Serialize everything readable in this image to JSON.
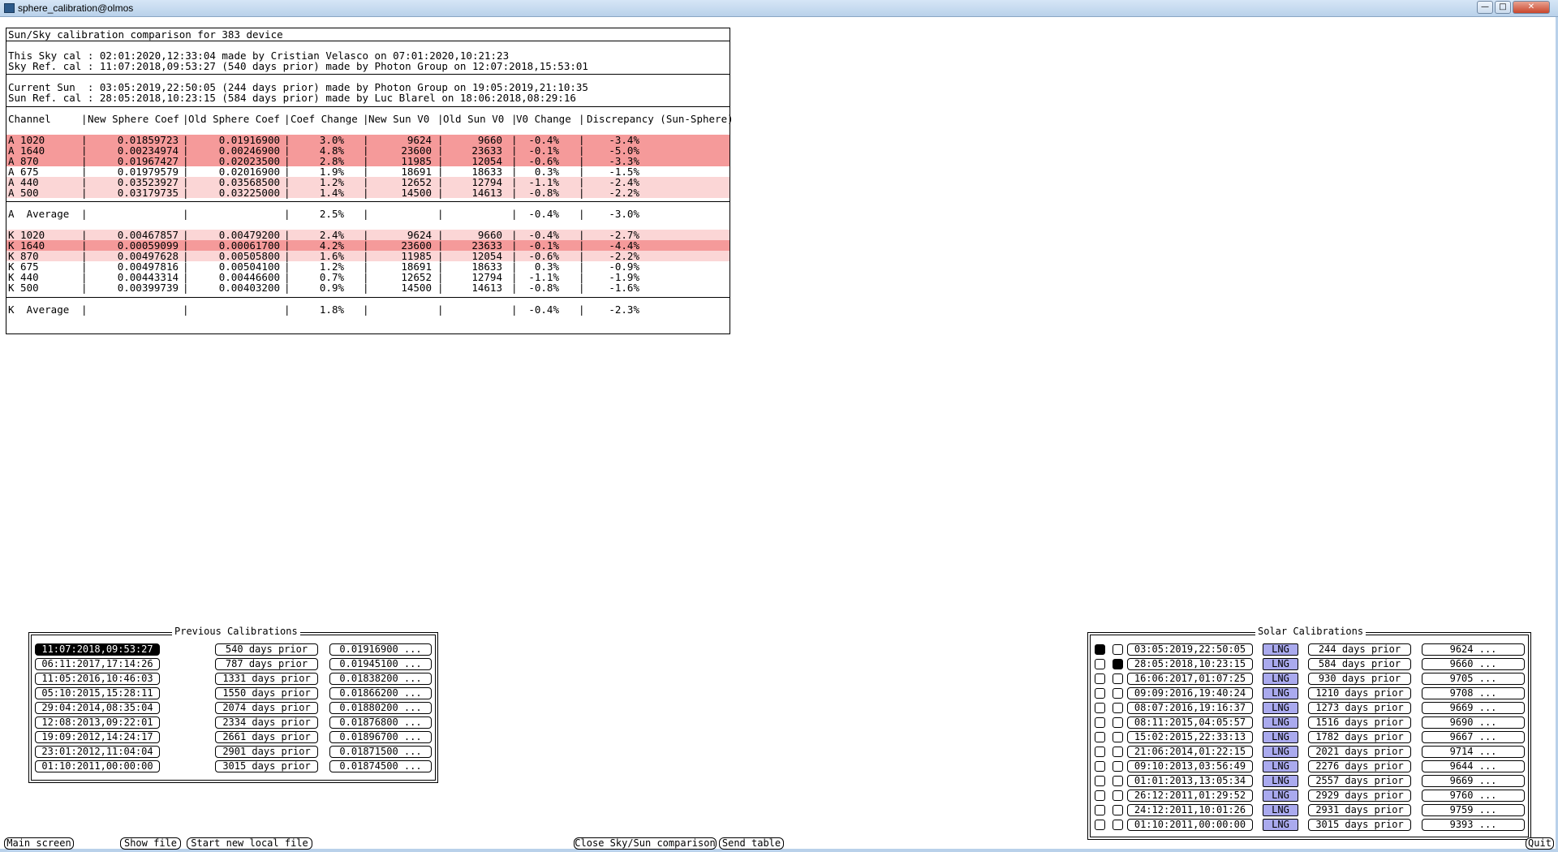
{
  "window": {
    "title": "sphere_calibration@olmos"
  },
  "report": {
    "title": "Sun/Sky calibration comparison for 383 device",
    "sky_lines": [
      "This Sky cal : 02:01:2020,12:33:04 made by Cristian Velasco on 07:01:2020,10:21:23",
      "Sky Ref. cal : 11:07:2018,09:53:27 (540 days prior) made by Photon Group on 12:07:2018,15:53:01"
    ],
    "sun_lines": [
      "Current Sun  : 03:05:2019,22:50:05 (244 days prior) made by Photon Group on 19:05:2019,21:10:35",
      "Sun Ref. cal : 28:05:2018,10:23:15 (584 days prior) made by Luc Blarel on 18:06:2018,08:29:16"
    ],
    "headers": [
      "Channel",
      "New Sphere Coef",
      "Old Sphere Coef",
      "Coef Change",
      "New Sun V0",
      "Old Sun V0",
      "V0 Change",
      "Discrepancy (Sun-Sphere)"
    ],
    "a_rows": [
      {
        "channel": "A 1020",
        "new_coef": "0.01859723",
        "old_coef": "0.01916900",
        "coef_change": "3.0%",
        "new_v0": "9624",
        "old_v0": "9660",
        "v0_change": "-0.4%",
        "disc": "-3.4%",
        "hl": "strong"
      },
      {
        "channel": "A 1640",
        "new_coef": "0.00234974",
        "old_coef": "0.00246900",
        "coef_change": "4.8%",
        "new_v0": "23600",
        "old_v0": "23633",
        "v0_change": "-0.1%",
        "disc": "-5.0%",
        "hl": "strong"
      },
      {
        "channel": "A 870",
        "new_coef": "0.01967427",
        "old_coef": "0.02023500",
        "coef_change": "2.8%",
        "new_v0": "11985",
        "old_v0": "12054",
        "v0_change": "-0.6%",
        "disc": "-3.3%",
        "hl": "strong"
      },
      {
        "channel": "A 675",
        "new_coef": "0.01979579",
        "old_coef": "0.02016900",
        "coef_change": "1.9%",
        "new_v0": "18691",
        "old_v0": "18633",
        "v0_change": "0.3%",
        "disc": "-1.5%",
        "hl": "none"
      },
      {
        "channel": "A 440",
        "new_coef": "0.03523927",
        "old_coef": "0.03568500",
        "coef_change": "1.2%",
        "new_v0": "12652",
        "old_v0": "12794",
        "v0_change": "-1.1%",
        "disc": "-2.4%",
        "hl": "light"
      },
      {
        "channel": "A 500",
        "new_coef": "0.03179735",
        "old_coef": "0.03225000",
        "coef_change": "1.4%",
        "new_v0": "14500",
        "old_v0": "14613",
        "v0_change": "-0.8%",
        "disc": "-2.2%",
        "hl": "light"
      }
    ],
    "a_average": {
      "channel": "A  Average",
      "coef_change": "2.5%",
      "v0_change": "-0.4%",
      "disc": "-3.0%"
    },
    "k_rows": [
      {
        "channel": "K 1020",
        "new_coef": "0.00467857",
        "old_coef": "0.00479200",
        "coef_change": "2.4%",
        "new_v0": "9624",
        "old_v0": "9660",
        "v0_change": "-0.4%",
        "disc": "-2.7%",
        "hl": "light"
      },
      {
        "channel": "K 1640",
        "new_coef": "0.00059099",
        "old_coef": "0.00061700",
        "coef_change": "4.2%",
        "new_v0": "23600",
        "old_v0": "23633",
        "v0_change": "-0.1%",
        "disc": "-4.4%",
        "hl": "strong"
      },
      {
        "channel": "K 870",
        "new_coef": "0.00497628",
        "old_coef": "0.00505800",
        "coef_change": "1.6%",
        "new_v0": "11985",
        "old_v0": "12054",
        "v0_change": "-0.6%",
        "disc": "-2.2%",
        "hl": "light"
      },
      {
        "channel": "K 675",
        "new_coef": "0.00497816",
        "old_coef": "0.00504100",
        "coef_change": "1.2%",
        "new_v0": "18691",
        "old_v0": "18633",
        "v0_change": "0.3%",
        "disc": "-0.9%",
        "hl": "none"
      },
      {
        "channel": "K 440",
        "new_coef": "0.00443314",
        "old_coef": "0.00446600",
        "coef_change": "0.7%",
        "new_v0": "12652",
        "old_v0": "12794",
        "v0_change": "-1.1%",
        "disc": "-1.9%",
        "hl": "none"
      },
      {
        "channel": "K 500",
        "new_coef": "0.00399739",
        "old_coef": "0.00403200",
        "coef_change": "0.9%",
        "new_v0": "14500",
        "old_v0": "14613",
        "v0_change": "-0.8%",
        "disc": "-1.6%",
        "hl": "none"
      }
    ],
    "k_average": {
      "channel": "K  Average",
      "coef_change": "1.8%",
      "v0_change": "-0.4%",
      "disc": "-2.3%"
    },
    "colors": {
      "strong": "#f59a9a",
      "light": "#fbd6d6"
    }
  },
  "previous": {
    "title": "Previous Calibrations",
    "rows": [
      {
        "date": "11:07:2018,09:53:27",
        "days": "540 days prior",
        "coef": "0.01916900 ...",
        "selected": true
      },
      {
        "date": "06:11:2017,17:14:26",
        "days": "787 days prior",
        "coef": "0.01945100 ...",
        "selected": false
      },
      {
        "date": "11:05:2016,10:46:03",
        "days": "1331 days prior",
        "coef": "0.01838200 ...",
        "selected": false
      },
      {
        "date": "05:10:2015,15:28:11",
        "days": "1550 days prior",
        "coef": "0.01866200 ...",
        "selected": false
      },
      {
        "date": "29:04:2014,08:35:04",
        "days": "2074 days prior",
        "coef": "0.01880200 ...",
        "selected": false
      },
      {
        "date": "12:08:2013,09:22:01",
        "days": "2334 days prior",
        "coef": "0.01876800 ...",
        "selected": false
      },
      {
        "date": "19:09:2012,14:24:17",
        "days": "2661 days prior",
        "coef": "0.01896700 ...",
        "selected": false
      },
      {
        "date": "23:01:2012,11:04:04",
        "days": "2901 days prior",
        "coef": "0.01871500 ...",
        "selected": false
      },
      {
        "date": "01:10:2011,00:00:00",
        "days": "3015 days prior",
        "coef": "0.01874500 ...",
        "selected": false
      }
    ]
  },
  "solar": {
    "title": "Solar Calibrations",
    "lng_label": "LNG",
    "rows": [
      {
        "c1": true,
        "c2": false,
        "date": "03:05:2019,22:50:05",
        "days": "244 days prior",
        "v0": "9624 ..."
      },
      {
        "c1": false,
        "c2": true,
        "date": "28:05:2018,10:23:15",
        "days": "584 days prior",
        "v0": "9660 ..."
      },
      {
        "c1": false,
        "c2": false,
        "date": "16:06:2017,01:07:25",
        "days": "930 days prior",
        "v0": "9705 ..."
      },
      {
        "c1": false,
        "c2": false,
        "date": "09:09:2016,19:40:24",
        "days": "1210 days prior",
        "v0": "9708 ..."
      },
      {
        "c1": false,
        "c2": false,
        "date": "08:07:2016,19:16:37",
        "days": "1273 days prior",
        "v0": "9669 ..."
      },
      {
        "c1": false,
        "c2": false,
        "date": "08:11:2015,04:05:57",
        "days": "1516 days prior",
        "v0": "9690 ..."
      },
      {
        "c1": false,
        "c2": false,
        "date": "15:02:2015,22:33:13",
        "days": "1782 days prior",
        "v0": "9667 ..."
      },
      {
        "c1": false,
        "c2": false,
        "date": "21:06:2014,01:22:15",
        "days": "2021 days prior",
        "v0": "9714 ..."
      },
      {
        "c1": false,
        "c2": false,
        "date": "09:10:2013,03:56:49",
        "days": "2276 days prior",
        "v0": "9644 ..."
      },
      {
        "c1": false,
        "c2": false,
        "date": "01:01:2013,13:05:34",
        "days": "2557 days prior",
        "v0": "9669 ..."
      },
      {
        "c1": false,
        "c2": false,
        "date": "26:12:2011,01:29:52",
        "days": "2929 days prior",
        "v0": "9760 ..."
      },
      {
        "c1": false,
        "c2": false,
        "date": "24:12:2011,10:01:26",
        "days": "2931 days prior",
        "v0": "9759 ..."
      },
      {
        "c1": false,
        "c2": false,
        "date": "01:10:2011,00:00:00",
        "days": "3015 days prior",
        "v0": "9393 ..."
      }
    ]
  },
  "bottom": {
    "main_screen": "Main screen",
    "show_file": "Show file",
    "start_local": "Start new local file",
    "close_comparison": "Close Sky/Sun comparison",
    "send_table": "Send table",
    "quit": "Quit"
  }
}
